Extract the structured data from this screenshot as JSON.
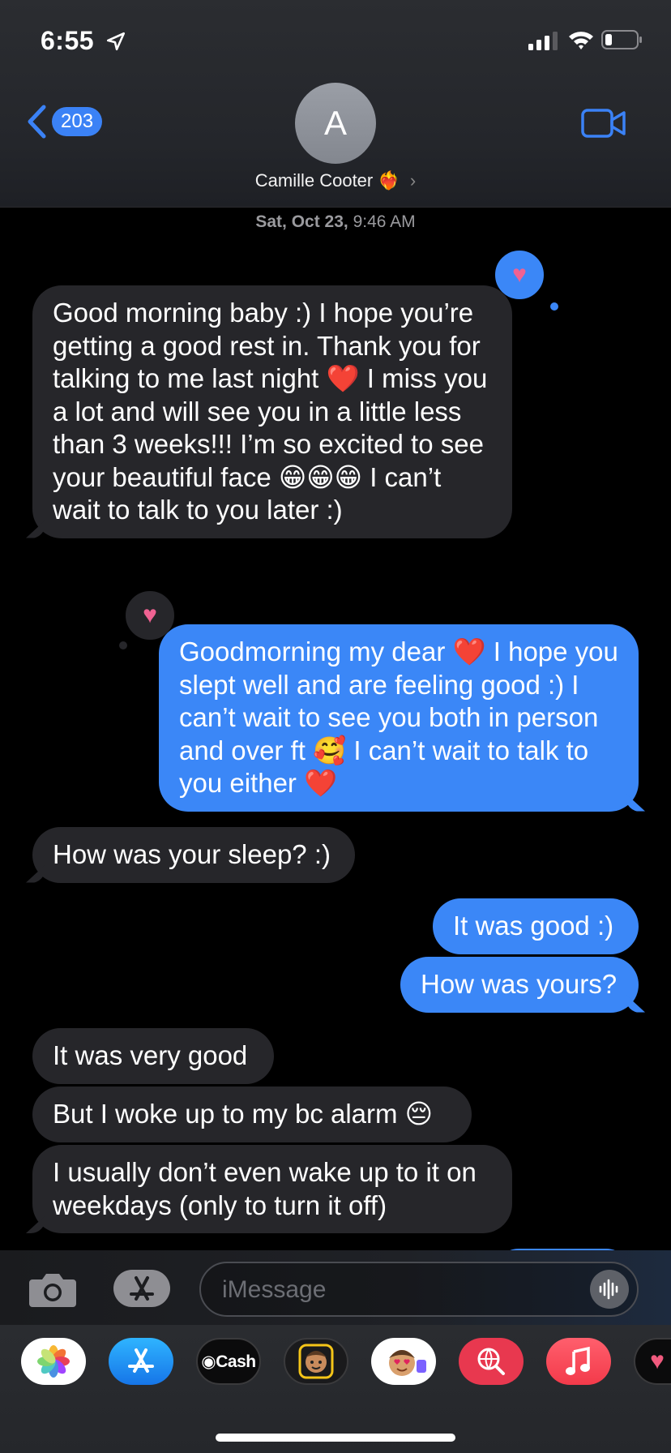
{
  "status": {
    "time": "6:55"
  },
  "nav": {
    "back_count": "203",
    "avatar_initial": "A",
    "contact_name": "Camille Cooter",
    "contact_emoji": "❤️‍🔥",
    "chevron": "›"
  },
  "thread": {
    "date_day": "Sat, Oct 23,",
    "date_time": "9:46 AM",
    "messages": [
      {
        "dir": "recv",
        "text": "Good morning baby :) I hope you’re getting a good rest in. Thank you for talking to me last night ❤️ I miss you a lot and will see you in a little less than 3 weeks!!! I’m so excited to see your beautiful face 😁😁😁 I can’t wait to talk to you later :)",
        "tapback": "heart"
      },
      {
        "dir": "sent",
        "text": "Goodmorning my dear ❤️ I hope you slept well and are feeling good :) I can’t wait to see you both in person and over ft 🥰 I can’t wait to talk to you either ❤️",
        "tapback": "heart"
      },
      {
        "dir": "recv",
        "text": "How was your sleep? :)"
      },
      {
        "dir": "sent",
        "text": "It was good :)"
      },
      {
        "dir": "sent",
        "text": "How was yours?"
      },
      {
        "dir": "recv",
        "text": "It was very good"
      },
      {
        "dir": "recv",
        "text": "But I woke up to my bc alarm 😔"
      },
      {
        "dir": "recv",
        "text": "I usually don’t even wake up to it on weekdays (only to turn it off)"
      }
    ]
  },
  "composer": {
    "placeholder": "iMessage"
  },
  "app_drawer": {
    "apps": [
      {
        "name": "photos",
        "label": ""
      },
      {
        "name": "app-store",
        "label": ""
      },
      {
        "name": "apple-cash",
        "label": "Cash"
      },
      {
        "name": "memoji",
        "label": ""
      },
      {
        "name": "memoji-stickers",
        "label": ""
      },
      {
        "name": "images-search",
        "label": ""
      },
      {
        "name": "music",
        "label": ""
      },
      {
        "name": "digital-touch",
        "label": ""
      }
    ]
  },
  "colors": {
    "sent_bubble": "#3b87f7",
    "recv_bubble": "#26262a",
    "accent": "#3b82f6",
    "tapback_heart": "#f06292"
  }
}
